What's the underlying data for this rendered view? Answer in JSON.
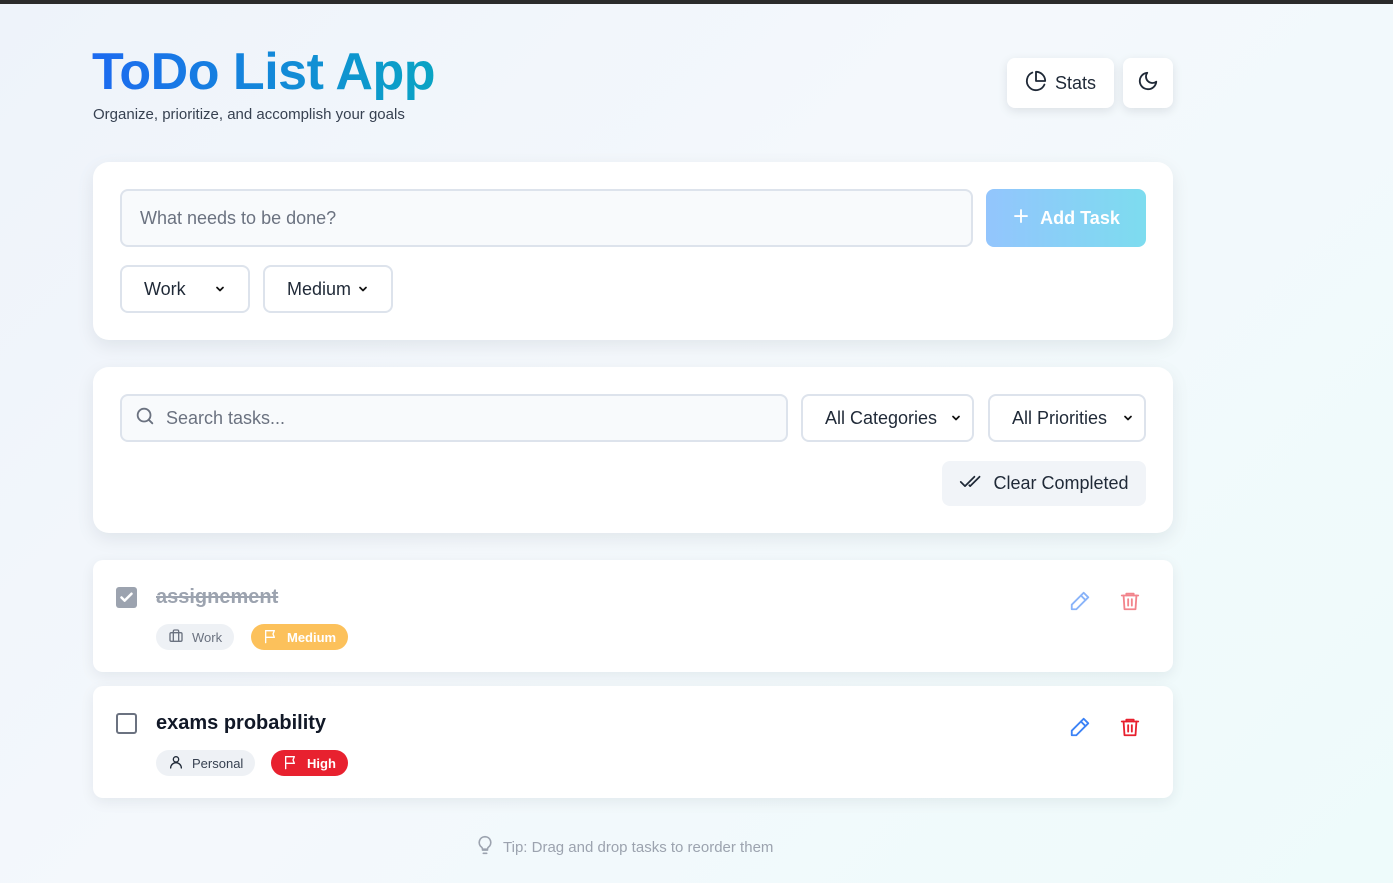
{
  "app": {
    "title": "ToDo List App",
    "subtitle": "Organize, prioritize, and accomplish your goals",
    "stats_label": "Stats"
  },
  "add_task": {
    "placeholder": "What needs to be done?",
    "button_label": "Add Task",
    "category_value": "Work",
    "priority_value": "Medium"
  },
  "filters": {
    "search_placeholder": "Search tasks...",
    "category_value": "All Categories",
    "priority_value": "All Priorities",
    "clear_label": "Clear Completed"
  },
  "tasks": [
    {
      "title": "assignement",
      "completed": true,
      "category": "Work",
      "category_icon": "briefcase-icon",
      "priority": "Medium",
      "priority_color": "#fcc15b"
    },
    {
      "title": "exams probability",
      "completed": false,
      "category": "Personal",
      "category_icon": "user-icon",
      "priority": "High",
      "priority_color": "#e8212f"
    }
  ],
  "tip": "Tip: Drag and drop tasks to reorder them",
  "colors": {
    "accent_blue": "#1d6af0",
    "accent_teal": "#0aa4c4",
    "edit": "#3b82f6",
    "delete": "#e8212f"
  }
}
